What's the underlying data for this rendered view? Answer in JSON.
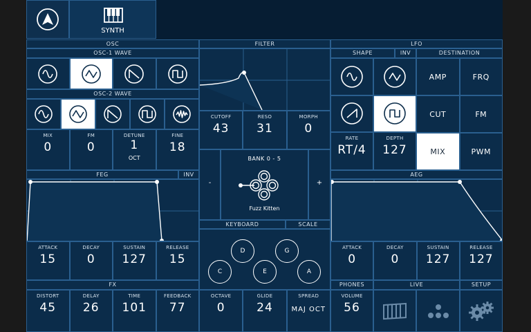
{
  "app": {
    "tab_synth": "SYNTH"
  },
  "osc": {
    "title": "OSC",
    "osc1_title": "OSC-1 WAVE",
    "osc2_title": "OSC-2 WAVE",
    "osc1_waves": [
      "sine",
      "triangle",
      "saw",
      "square"
    ],
    "osc1_selected": 1,
    "osc2_waves": [
      "sine",
      "triangle",
      "saw",
      "square",
      "noise"
    ],
    "osc2_selected": 1,
    "params": [
      {
        "label": "MIX",
        "value": "0"
      },
      {
        "label": "FM",
        "value": "0"
      },
      {
        "label": "DETUNE",
        "value": "1",
        "sub": "OCT"
      },
      {
        "label": "FINE",
        "value": "18"
      }
    ]
  },
  "filter": {
    "title": "FILTER",
    "params": [
      {
        "label": "CUTOFF",
        "value": "43"
      },
      {
        "label": "RESO",
        "value": "31"
      },
      {
        "label": "MORPH",
        "value": "0"
      }
    ]
  },
  "lfo": {
    "title": "LFO",
    "shape_title": "SHAPE",
    "inv_label": "INV",
    "dest_title": "DESTINATION",
    "shapes": [
      "sine",
      "triangle",
      "ramp-down",
      "square"
    ],
    "shape_selected": 3,
    "destinations": [
      "AMP",
      "FRQ",
      "CUT",
      "FM",
      "MIX",
      "PWM"
    ],
    "dest_selected": "MIX",
    "params": [
      {
        "label": "RATE",
        "value": "RT/4"
      },
      {
        "label": "DEPTH",
        "value": "127"
      }
    ]
  },
  "bank": {
    "title": "BANK 0 - 5",
    "preset": "Fuzz Kitten",
    "minus": "-",
    "plus": "+"
  },
  "feg": {
    "title": "FEG",
    "inv_label": "INV",
    "params": [
      {
        "label": "ATTACK",
        "value": "15"
      },
      {
        "label": "DECAY",
        "value": "0"
      },
      {
        "label": "SUSTAIN",
        "value": "127"
      },
      {
        "label": "RELEASE",
        "value": "15"
      }
    ]
  },
  "aeg": {
    "title": "AEG",
    "params": [
      {
        "label": "ATTACK",
        "value": "0"
      },
      {
        "label": "DECAY",
        "value": "0"
      },
      {
        "label": "SUSTAIN",
        "value": "127"
      },
      {
        "label": "RELEASE",
        "value": "127"
      }
    ]
  },
  "keyboard": {
    "title": "KEYBOARD",
    "scale_label": "SCALE",
    "keys": [
      "C",
      "D",
      "E",
      "G",
      "A"
    ],
    "params": [
      {
        "label": "OCTAVE",
        "value": "0"
      },
      {
        "label": "GLIDE",
        "value": "24"
      },
      {
        "label": "SPREAD",
        "value": "MAJ OCT"
      }
    ]
  },
  "fx": {
    "title": "FX",
    "params": [
      {
        "label": "DISTORT",
        "value": "45"
      },
      {
        "label": "DELAY",
        "value": "26"
      },
      {
        "label": "TIME",
        "value": "101"
      },
      {
        "label": "FEEDBACK",
        "value": "77"
      }
    ]
  },
  "phones": {
    "title": "PHONES",
    "param": {
      "label": "VOLUME",
      "value": "56"
    }
  },
  "live": {
    "title": "LIVE"
  },
  "setup": {
    "title": "SETUP"
  }
}
